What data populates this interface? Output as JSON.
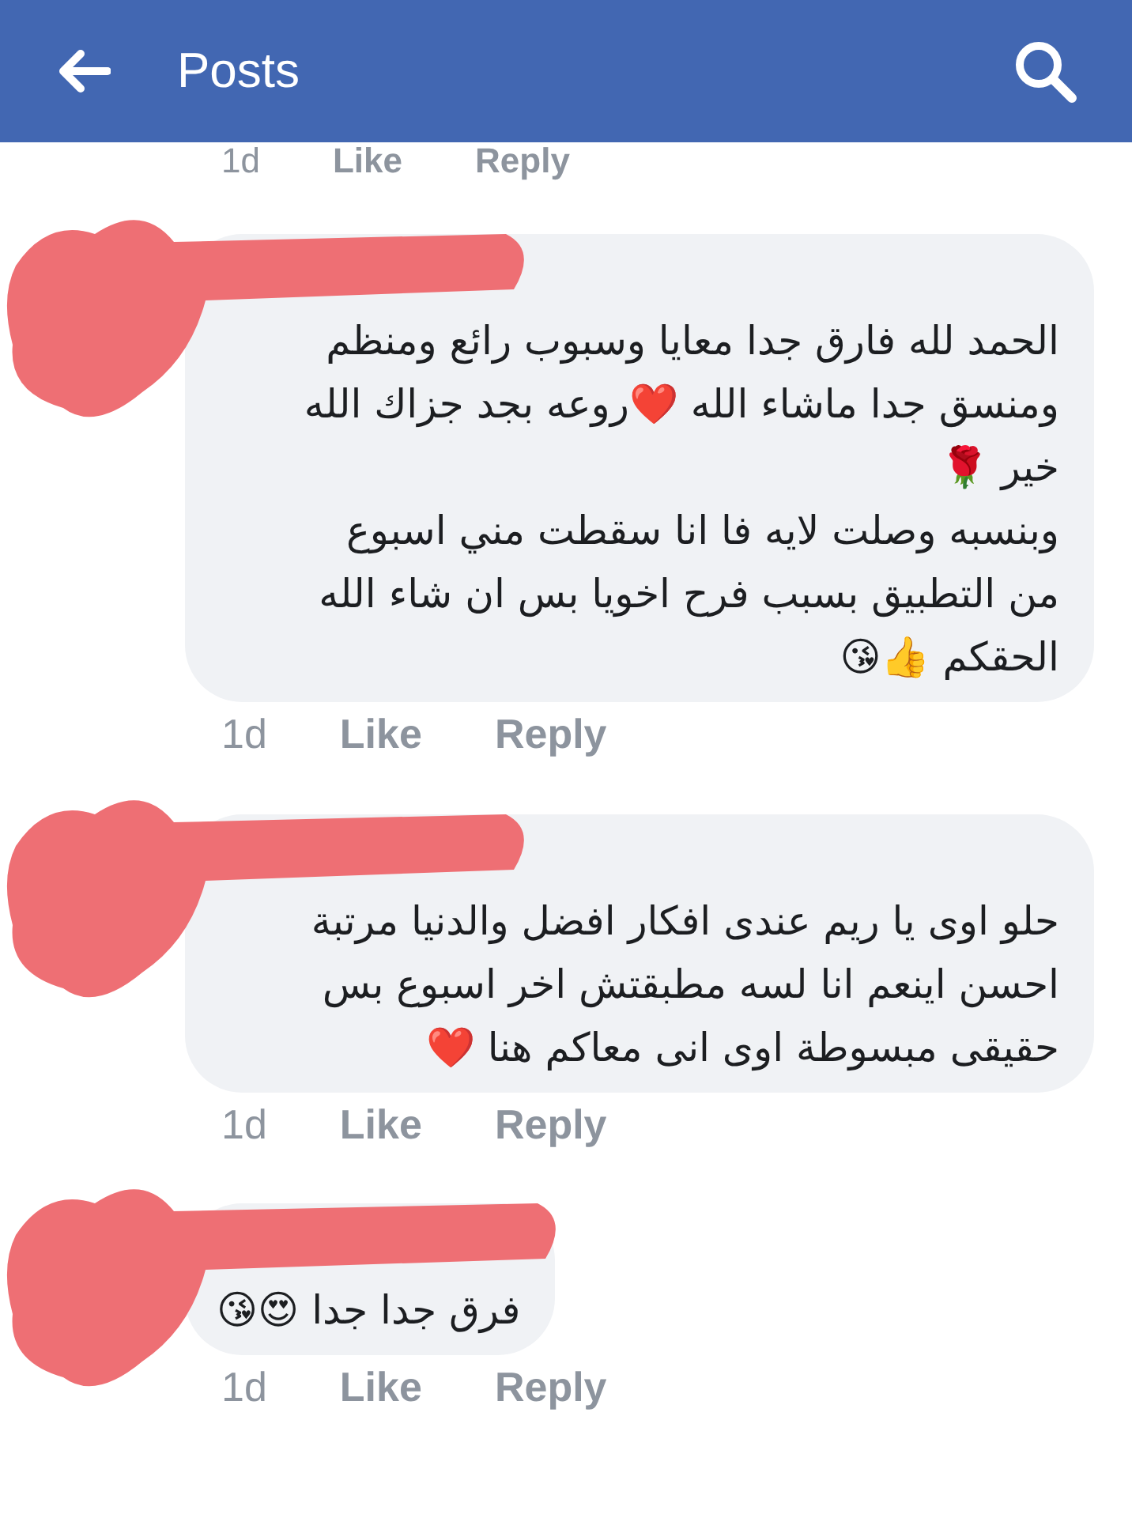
{
  "header": {
    "title": "Posts"
  },
  "previous_actions": {
    "time": "1d",
    "like": "Like",
    "reply": "Reply"
  },
  "comments": [
    {
      "redacted": true,
      "text": "الحمد لله فارق جدا معايا وسبوب رائع ومنظم\nومنسق جدا ماشاء الله ❤️روعه بجد جزاك الله\nخير 🌹\nوبنسبه وصلت لايه فا انا سقطت مني اسبوع\nمن التطبيق بسبب فرح اخويا بس ان شاء الله\nالحقكم 👍😘",
      "time": "1d",
      "like": "Like",
      "reply": "Reply"
    },
    {
      "redacted": true,
      "text": "حلو اوى يا ريم عندى افكار افضل والدنيا مرتبة\nاحسن اينعم انا لسه مطبقتش اخر اسبوع بس\nحقيقى مبسوطة اوى انى معاكم هنا ❤️",
      "time": "1d",
      "like": "Like",
      "reply": "Reply"
    },
    {
      "redacted": true,
      "text": "فرق جدا جدا 😍😘",
      "time": "1d",
      "like": "Like",
      "reply": "Reply"
    }
  ]
}
